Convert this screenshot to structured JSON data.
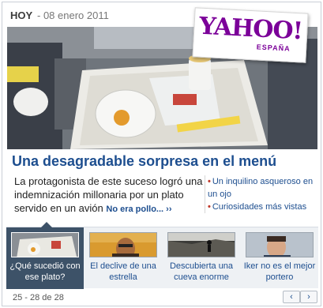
{
  "header": {
    "today_label": "HOY",
    "date": "- 08 enero 2011"
  },
  "logo": {
    "brand": "YAHOO!",
    "country": "ESPAÑA"
  },
  "feature": {
    "headline": "Una desagradable sorpresa en el menú",
    "summary": "La protagonista de este suceso logró una indemnización millonaria por un plato servido en un avión",
    "more_link": "No era pollo... ››"
  },
  "related": [
    {
      "text": "Un inquilino asqueroso en un ojo"
    },
    {
      "text": "Curiosidades más vistas"
    }
  ],
  "thumbnails": [
    {
      "caption": "¿Qué sucedió con ese plato?",
      "active": true
    },
    {
      "caption": "El declive de una estrella",
      "active": false
    },
    {
      "caption": "Descubierta una cueva enorme",
      "active": false
    },
    {
      "caption": "Iker no es el mejor portero",
      "active": false
    }
  ],
  "footer": {
    "range": "25 - 28 de 28",
    "prev_label": "‹",
    "next_label": "›"
  },
  "colors": {
    "headline_blue": "#1d4e8f",
    "brand_purple": "#7b0099",
    "active_thumb_bg": "#3d5268",
    "bullet_red": "#c0392b"
  }
}
